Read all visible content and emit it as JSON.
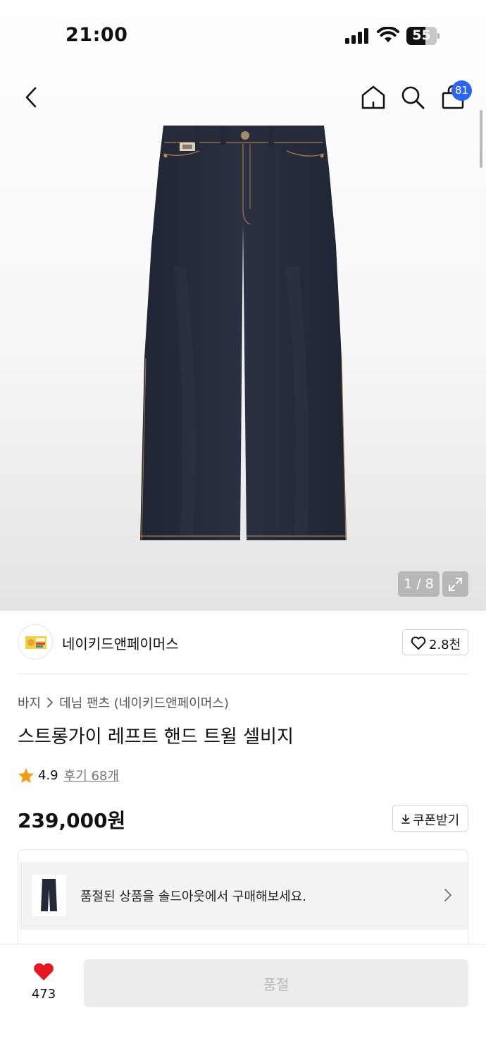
{
  "status_bar": {
    "time": "21:00",
    "battery": "55"
  },
  "nav": {
    "cart_badge": "81"
  },
  "gallery": {
    "pager": "1 / 8"
  },
  "brand": {
    "name": "네이키드앤페이머스",
    "like_count": "2.8천"
  },
  "breadcrumb": {
    "category": "바지",
    "subcategory": "데님 팬츠 (네이키드앤페이머스)"
  },
  "product": {
    "title": "스트롱가이 레프트 핸드 트윌 셀비지",
    "rating": "4.9",
    "review_link": "후기 68개",
    "price": "239,000원",
    "coupon_label": "쿠폰받기"
  },
  "soldout_banner": {
    "text": "품절된 상품을 솔드아웃에서 구매해보세요."
  },
  "bottom_bar": {
    "wish_count": "473",
    "buy_label": "품절"
  },
  "colors": {
    "accent_blue": "#2b64f2",
    "heart_red": "#e8161e",
    "star_orange": "#f59a13"
  }
}
